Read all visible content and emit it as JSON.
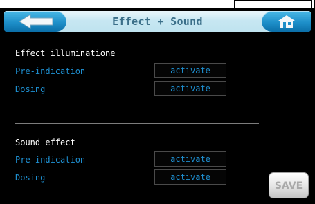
{
  "header": {
    "title": "Effect + Sound"
  },
  "effect": {
    "title": "Effect illuminatione",
    "rows": [
      {
        "label": "Pre-indication",
        "value": "activate"
      },
      {
        "label": "Dosing",
        "value": "activate"
      }
    ]
  },
  "sound": {
    "title": "Sound effect",
    "rows": [
      {
        "label": "Pre-indication",
        "value": "activate"
      },
      {
        "label": "Dosing",
        "value": "activate"
      }
    ]
  },
  "save_label": "SAVE",
  "icons": {
    "back": "arrow-left-icon",
    "home": "home-icon"
  },
  "colors": {
    "background": "#000000",
    "label": "#1e8fd0",
    "header": "#bfe3ef",
    "button": "#1e8fc9"
  }
}
